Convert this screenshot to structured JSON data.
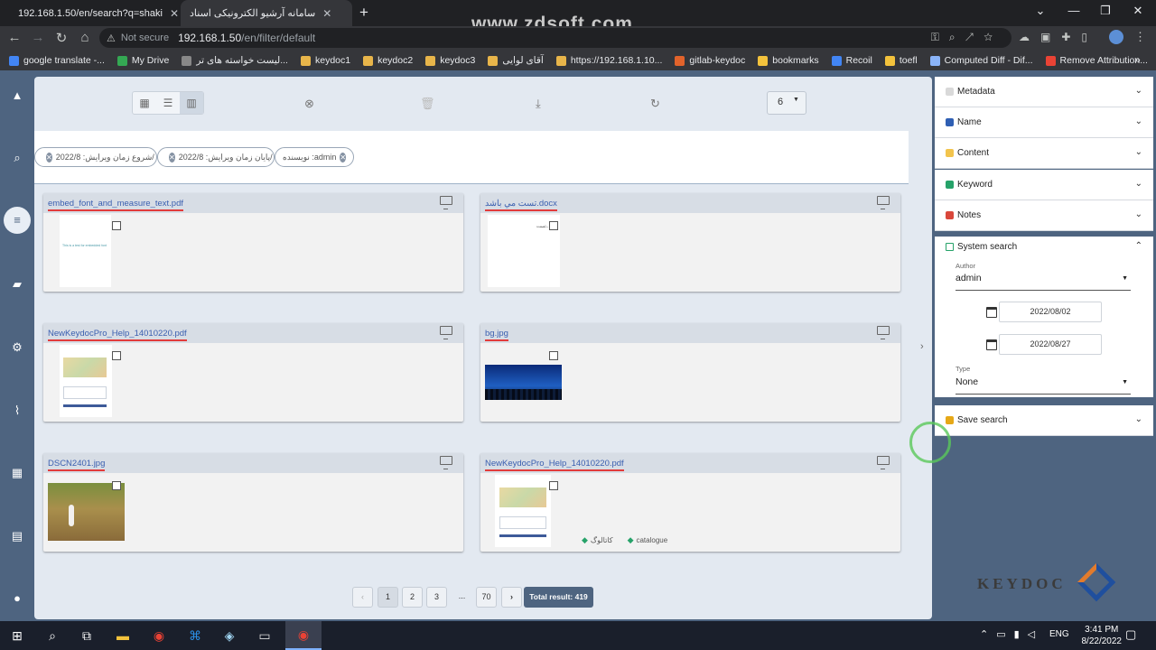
{
  "browser": {
    "tabs": [
      {
        "title": "192.168.1.50/en/search?q=shaki",
        "active": false
      },
      {
        "title": "سامانه آرشیو الکترونیکی اسناد",
        "active": true
      }
    ],
    "new_tab_label": "+",
    "watermark": "www.zdsoft.com",
    "security_label": "Not secure",
    "url_host": "192.168.1.50",
    "url_path": "/en/filter/default",
    "bookmarks": [
      "google translate -...",
      "My Drive",
      "لیست خواسته های تر...",
      "keydoc1",
      "keydoc2",
      "keydoc3",
      "آقای لوایی",
      "https://192.168.1.10...",
      "gitlab-keydoc",
      "bookmarks",
      "Recoil",
      "toefl",
      "Computed Diff - Dif...",
      "Remove Attribution..."
    ]
  },
  "toolbar": {
    "page_size": "6"
  },
  "filter_chips": [
    {
      "label": "شروع زمان ویرایش: 2022/8/"
    },
    {
      "label": "پایان زمان ویرایش: 2022/8/"
    },
    {
      "label": "نویسنده :admin"
    }
  ],
  "results": [
    {
      "title": "embed_font_and_measure_text.pdf",
      "thumb_text": "This is a test for embedded font"
    },
    {
      "title": "تست مي باشد.docx",
      "thumb_text": "تست..."
    },
    {
      "title": "NewKeydocPro_Help_14010220.pdf",
      "thumb_text": ""
    },
    {
      "title": "bg.jpg",
      "thumb_text": ""
    },
    {
      "title": "DSCN2401.jpg",
      "thumb_text": ""
    },
    {
      "title": "NewKeydocPro_Help_14010220.pdf",
      "thumb_text": "",
      "tags": [
        "کاتالوگ",
        "catalogue"
      ]
    }
  ],
  "pagination": {
    "pages": [
      "1",
      "2",
      "3",
      "...",
      "70"
    ],
    "current": "1",
    "prev": "‹",
    "next": "›",
    "total_label": "Total result: 419"
  },
  "panel": {
    "sections": [
      {
        "label": "Metadata",
        "color": "#d9d9d9"
      },
      {
        "label": "Name",
        "color": "#2f5fb3"
      },
      {
        "label": "Content",
        "color": "#f2c44d"
      },
      {
        "label": "Keyword",
        "color": "#26a269"
      },
      {
        "label": "Notes",
        "color": "#d9473b"
      }
    ],
    "system_search": {
      "label": "System search",
      "color": "#26a269",
      "author_label": "Author",
      "author_value": "admin",
      "date_from": "2022/08/02",
      "date_to": "2022/08/27",
      "type_label": "Type",
      "type_value": "None"
    },
    "save_search": {
      "label": "Save search",
      "color": "#e6a817"
    }
  },
  "logo": "KEYDOC",
  "taskbar": {
    "language": "ENG",
    "time": "3:41 PM",
    "date": "8/22/2022"
  }
}
